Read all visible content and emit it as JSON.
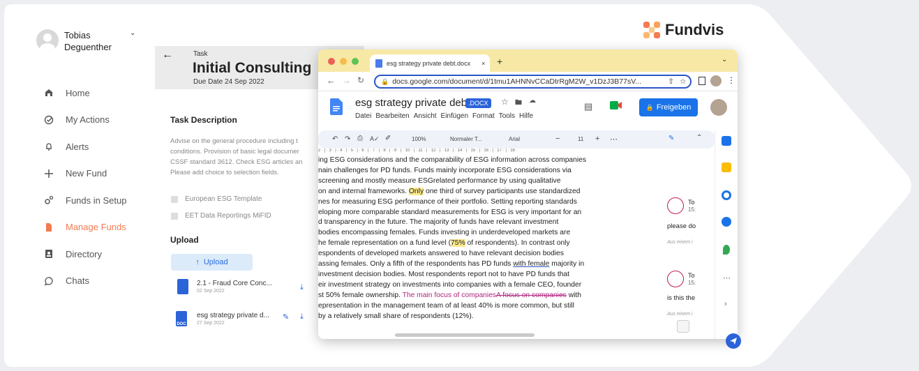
{
  "user": {
    "name": "Tobias Deguenther"
  },
  "nav": [
    {
      "label": "Home",
      "icon": "home-icon"
    },
    {
      "label": "My Actions",
      "icon": "check-circle-icon"
    },
    {
      "label": "Alerts",
      "icon": "bell-icon"
    },
    {
      "label": "New Fund",
      "icon": "plus-icon"
    },
    {
      "label": "Funds in Setup",
      "icon": "gears-icon"
    },
    {
      "label": "Manage Funds",
      "icon": "file-icon",
      "active": true
    },
    {
      "label": "Directory",
      "icon": "contact-icon"
    },
    {
      "label": "Chats",
      "icon": "chat-icon"
    }
  ],
  "task": {
    "label": "Task",
    "title": "Initial Consulting",
    "due": "Due Date 24 Sep 2022",
    "description_title": "Task Description",
    "description_lines": [
      "Advise on the general procedure including t",
      "conditions. Provision of basic legal documer",
      "CSSF standard 3612. Check ESG articles an",
      "Please add choice to selection fields."
    ],
    "checkboxes": [
      "European ESG Template",
      "EET Data Reportings MiFID"
    ],
    "upload_title": "Upload",
    "upload_button": "Upload",
    "files": [
      {
        "name": "2.1 - Fraud Core Conc...",
        "date": "02 Sep 2022"
      },
      {
        "name": "esg strategy private d...",
        "date": "27 Sep 2022",
        "badge": "DOC"
      }
    ]
  },
  "brand": {
    "name": "Fundvis",
    "accent": "#f47b50"
  },
  "browser": {
    "tab_title": "esg strategy private debt.docx",
    "url": "docs.google.com/document/d/1tmu1AHNNvCCaDtrRgM2W_v1DzJ3B77sV..."
  },
  "gdoc": {
    "title": "esg strategy private debt",
    "badge": ".DOCX",
    "menu": [
      "Datei",
      "Bearbeiten",
      "Ansicht",
      "Einfügen",
      "Format",
      "Tools",
      "Hilfe"
    ],
    "share_label": "Freigeben",
    "zoom": "100%",
    "style": "Normaler T...",
    "font": "Arial",
    "font_size": "11",
    "ruler": "2 · | · 3 · | · 4 · | · 5 · | · 6 · | · 7 · | · 8 · | · 9 · | · 10 · | · 11 · | · 12 · | · 13 · | · 14 · | · 15 · | · 16 · | · 17 · | · 18 ·"
  },
  "doc_text": {
    "l1": "ing ESG considerations and the comparability of ESG information across companies",
    "l2": "nain challenges for PD funds. Funds mainly incorporate ESG considerations via",
    "l3": "screening and mostly measure ESGrelated performance by using qualitative",
    "l4a": "on and internal frameworks. ",
    "l4b": "Only",
    "l4c": " one third of survey participants use standardized",
    "l5": "nes for measuring ESG performance of their portfolio. Setting reporting standards",
    "l6": "eloping more comparable standard measurements for ESG is very important for an",
    "l7": "d transparency in the future. The majority of funds have relevant investment",
    "l8": "bodies encompassing females. Funds investing in underdeveloped markets are",
    "l9a": "he female representation on a fund level (",
    "l9b": "75%",
    "l9c": " of respondents). In contrast only",
    "l10": "espondents of developed markets answered to have relevant decision bodies",
    "l11a": "assing females. Only a fifth of the respondents has PD funds ",
    "l11b": "with female",
    "l11c": " majority in",
    "l12": "investment decision bodies. Most respondents report not to have PD funds that",
    "l13": "eir investment strategy on investments into companies with a female CEO, founder",
    "l14a": "st 50% female ownership. ",
    "l14b": "The main focus of companies",
    "l14c": "A focus on companies",
    "l14d": " with",
    "l15": "epresentation in the management team of at least 40% is more common, but still",
    "l16": "by a relatively small share of respondents (12%)."
  },
  "comments": [
    {
      "initials": "To",
      "time": "15:",
      "text": "please do",
      "meta": "Aus einem i"
    },
    {
      "initials": "To",
      "time": "15:",
      "text": "is this the",
      "meta": "Aus einem i"
    }
  ]
}
